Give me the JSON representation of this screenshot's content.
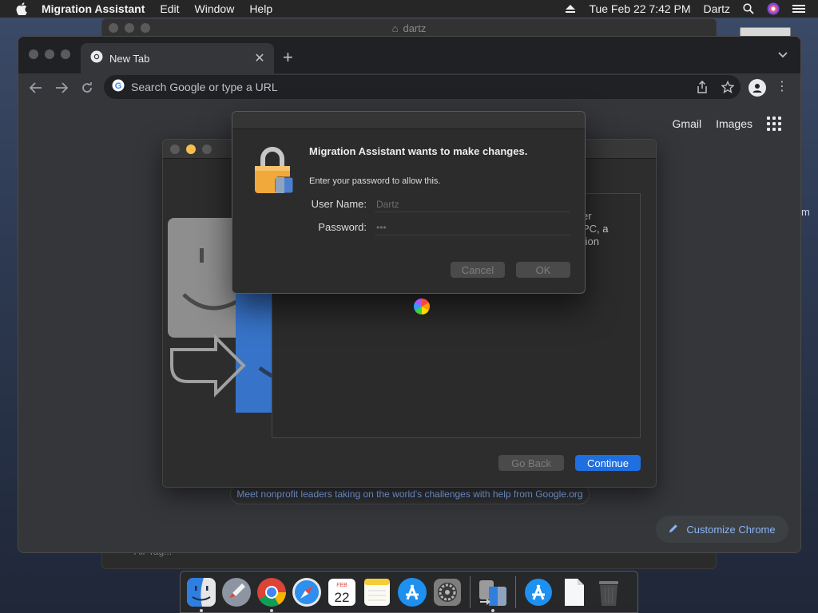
{
  "menubar": {
    "app_name": "Migration Assistant",
    "items": [
      "Edit",
      "Window",
      "Help"
    ],
    "datetime": "Tue Feb 22  7:42 PM",
    "user": "Dartz"
  },
  "background_window": {
    "title": "dartz",
    "sidebar_label": "Air Tag..."
  },
  "chrome": {
    "tab_title": "New Tab",
    "omnibox_placeholder": "Search Google or type a URL",
    "gmail_link": "Gmail",
    "images_link": "Images",
    "promo_text": "Meet nonprofit leaders taking on the world's challenges with help from Google.org",
    "customize_label": "Customize Chrome"
  },
  "migration_window": {
    "panel_text_lines": [
      "er",
      "PC, a",
      "tion"
    ],
    "back_label": "Go Back",
    "continue_label": "Continue",
    "accent_color": "#1f6fe0"
  },
  "auth_dialog": {
    "heading": "Migration Assistant wants to make changes.",
    "subtext": "Enter your password to allow this.",
    "username_label": "User Name:",
    "username_value": "Dartz",
    "password_label": "Password:",
    "password_value": "•••",
    "cancel_label": "Cancel",
    "ok_label": "OK"
  },
  "right_partial_text": "m",
  "dock": {
    "items": [
      "finder-icon",
      "launchpad-icon",
      "chrome-icon",
      "safari-icon",
      "calendar-icon",
      "notes-icon",
      "app-store-icon",
      "system-preferences-icon",
      "migration-assistant-icon",
      "app-store-folder-icon",
      "document-icon",
      "trash-icon"
    ],
    "calendar_month": "FEB",
    "calendar_day": "22"
  }
}
